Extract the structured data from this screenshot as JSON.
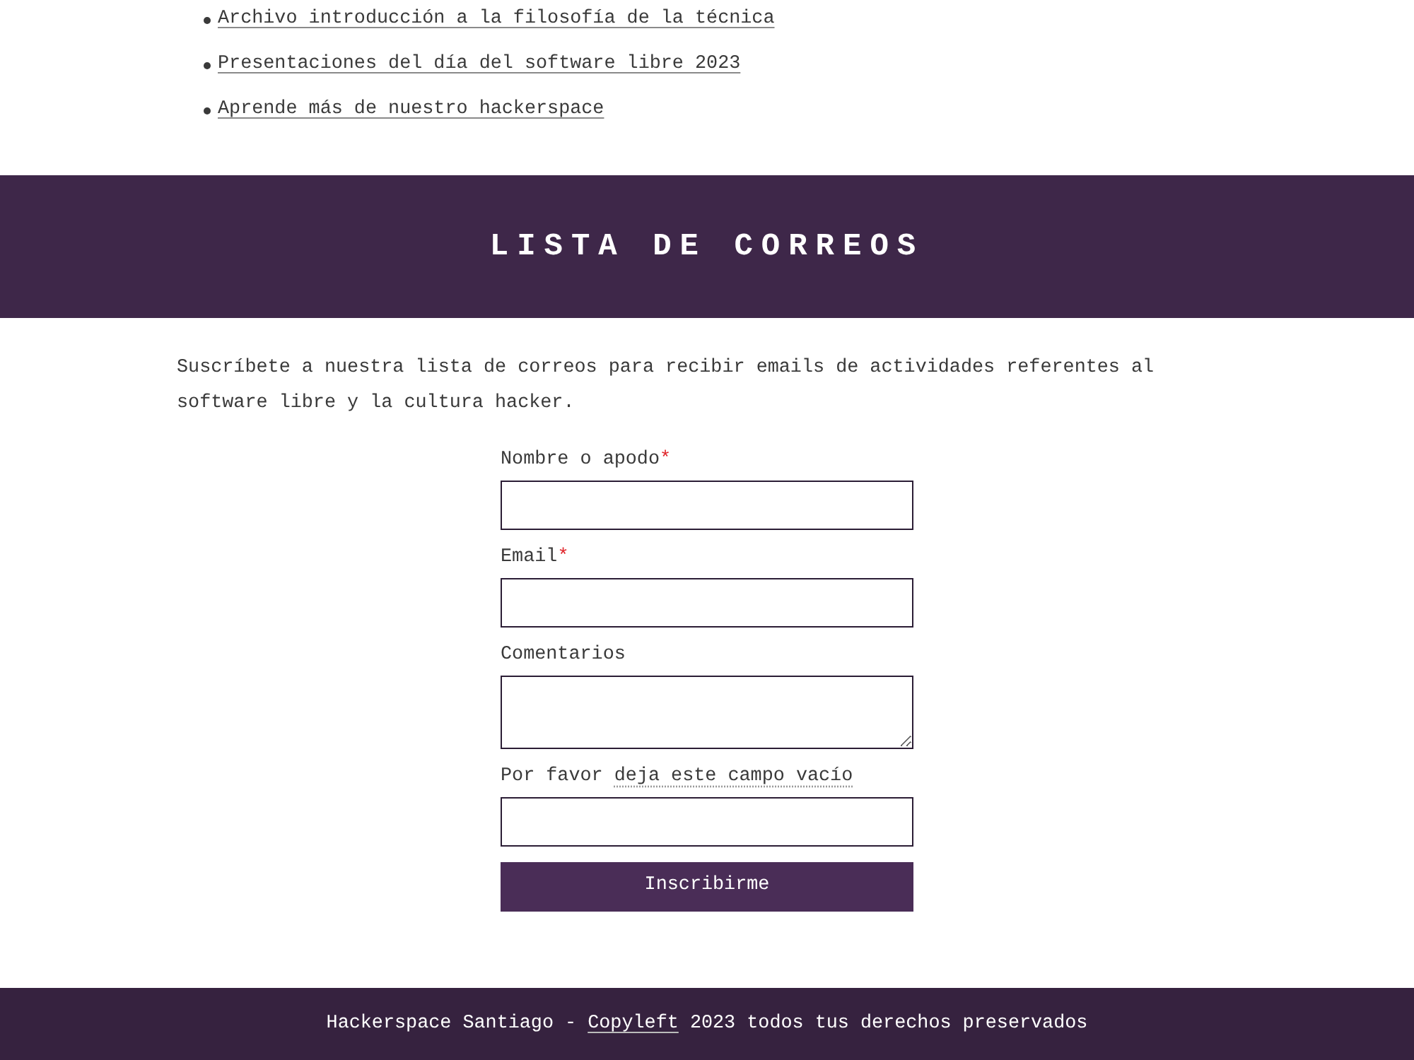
{
  "links": [
    {
      "label": "Archivo introducción a la filosofía de la técnica"
    },
    {
      "label": "Presentaciones del día del software libre 2023"
    },
    {
      "label": "Aprende más de nuestro hackerspace"
    }
  ],
  "banner": {
    "title": "LISTA DE CORREOS"
  },
  "intro": "Suscríbete a nuestra lista de correos para recibir emails de actividades referentes al software libre y la cultura hacker.",
  "form": {
    "fields": [
      {
        "kind": "text",
        "label": "Nombre o apodo",
        "required": true
      },
      {
        "kind": "text",
        "label": "Email",
        "required": true
      },
      {
        "kind": "textarea",
        "label": "Comentarios",
        "required": false
      },
      {
        "kind": "text",
        "label": "Por favor",
        "label_hint": "deja este campo vacío",
        "required": false
      }
    ],
    "required_mark": "*",
    "submit": "Inscribirme"
  },
  "footer": {
    "before": "Hackerspace Santiago - ",
    "link": "Copyleft",
    "after": " 2023 todos tus derechos preservados"
  }
}
